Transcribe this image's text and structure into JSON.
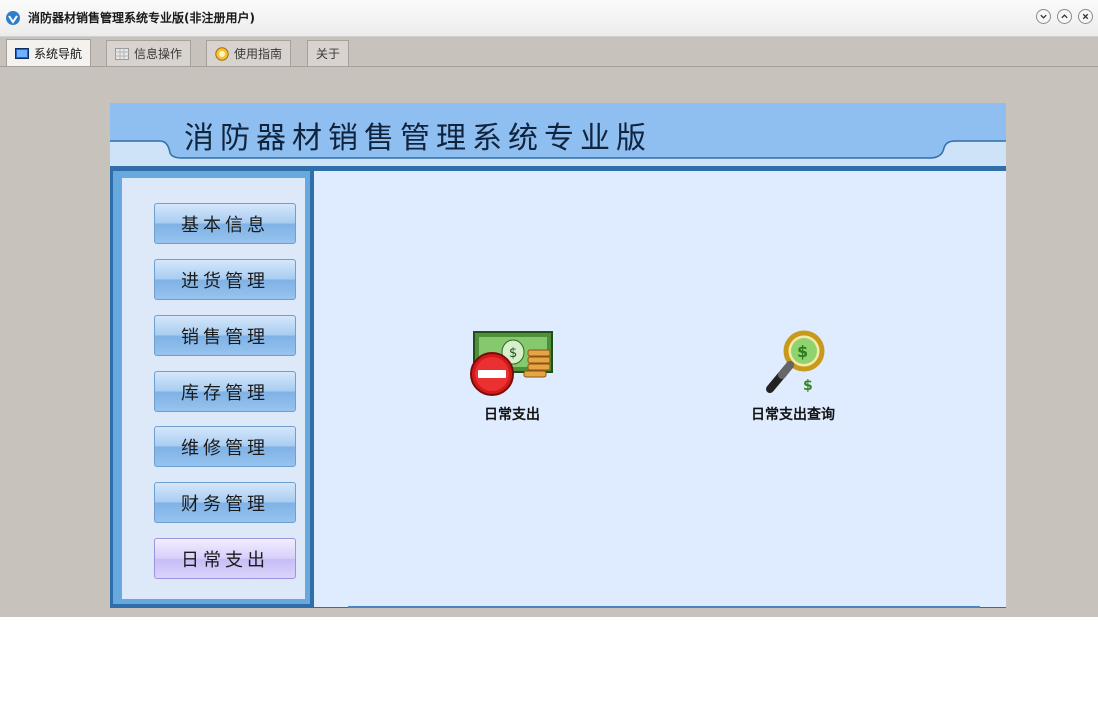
{
  "window": {
    "title": "消防器材销售管理系统专业版(非注册用户)",
    "controls": [
      "minimize-icon",
      "maximize-icon",
      "close-icon"
    ]
  },
  "tabs": [
    {
      "label": "系统导航",
      "icon": "monitor-icon",
      "active": true
    },
    {
      "label": "信息操作",
      "icon": "grid-icon",
      "active": false
    },
    {
      "label": "使用指南",
      "icon": "help-icon",
      "active": false
    },
    {
      "label": "关于",
      "icon": "",
      "active": false
    }
  ],
  "banner": {
    "title": "消防器材销售管理系统专业版"
  },
  "sidebar": {
    "items": [
      {
        "label": "基本信息"
      },
      {
        "label": "进货管理"
      },
      {
        "label": "销售管理"
      },
      {
        "label": "库存管理"
      },
      {
        "label": "维修管理"
      },
      {
        "label": "财务管理"
      },
      {
        "label": "日常支出",
        "selected": true
      }
    ]
  },
  "main": {
    "actions": [
      {
        "label": "日常支出",
        "icon": "expense-money-icon"
      },
      {
        "label": "日常支出查询",
        "icon": "money-search-icon"
      }
    ]
  },
  "colors": {
    "window_bg": "#c8c2bd",
    "banner": "#8fbff0",
    "panel": "#dfebfe",
    "nav_button": "#a9cdf1",
    "nav_selected": "#d7cffb"
  }
}
